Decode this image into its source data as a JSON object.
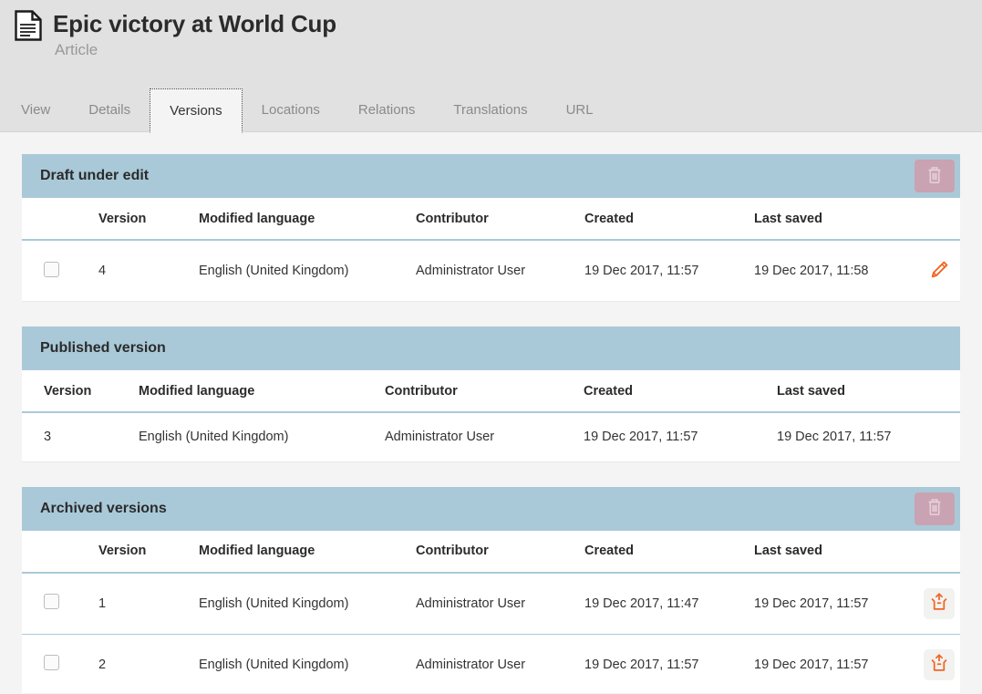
{
  "header": {
    "icon": "article-document-icon",
    "title": "Epic victory at World Cup",
    "subtitle": "Article"
  },
  "tabs": [
    {
      "label": "View",
      "name": "tab-view",
      "active": false
    },
    {
      "label": "Details",
      "name": "tab-details",
      "active": false
    },
    {
      "label": "Versions",
      "name": "tab-versions",
      "active": true
    },
    {
      "label": "Locations",
      "name": "tab-locations",
      "active": false
    },
    {
      "label": "Relations",
      "name": "tab-relations",
      "active": false
    },
    {
      "label": "Translations",
      "name": "tab-translations",
      "active": false
    },
    {
      "label": "URL",
      "name": "tab-url",
      "active": false
    }
  ],
  "columns": {
    "version": "Version",
    "modified_language": "Modified language",
    "contributor": "Contributor",
    "created": "Created",
    "last_saved": "Last saved"
  },
  "sections": {
    "draft": {
      "title": "Draft under edit",
      "has_checkboxes": true,
      "has_delete_button": true,
      "delete_icon": "trash-icon",
      "rows": [
        {
          "version": "4",
          "modified_language": "English (United Kingdom)",
          "contributor": "Administrator User",
          "created": "19 Dec 2017, 11:57",
          "last_saved": "19 Dec 2017, 11:58",
          "action_icon": "pencil-edit-icon"
        }
      ]
    },
    "published": {
      "title": "Published version",
      "has_checkboxes": false,
      "has_delete_button": false,
      "rows": [
        {
          "version": "3",
          "modified_language": "English (United Kingdom)",
          "contributor": "Administrator User",
          "created": "19 Dec 2017, 11:57",
          "last_saved": "19 Dec 2017, 11:57",
          "action_icon": ""
        }
      ]
    },
    "archived": {
      "title": "Archived versions",
      "has_checkboxes": true,
      "has_delete_button": true,
      "delete_icon": "trash-icon",
      "rows": [
        {
          "version": "1",
          "modified_language": "English (United Kingdom)",
          "contributor": "Administrator User",
          "created": "19 Dec 2017, 11:47",
          "last_saved": "19 Dec 2017, 11:57",
          "action_icon": "restore-archive-icon"
        },
        {
          "version": "2",
          "modified_language": "English (United Kingdom)",
          "contributor": "Administrator User",
          "created": "19 Dec 2017, 11:57",
          "last_saved": "19 Dec 2017, 11:57",
          "action_icon": "restore-archive-icon"
        }
      ]
    }
  },
  "colors": {
    "section_header_bg": "#a9c9d8",
    "header_bg": "#e2e1e1",
    "content_bg": "#f4f4f4",
    "accent_orange": "#f26522",
    "delete_button_bg": "#c9a3b1"
  }
}
